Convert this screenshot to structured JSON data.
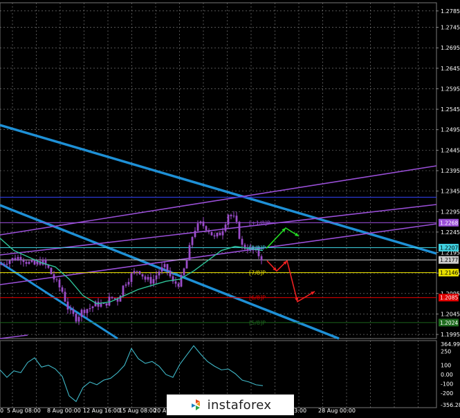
{
  "colors": {
    "background": "#000000",
    "grid": "#8a8a8a",
    "text": "#ffffff",
    "candles": "#9b4dca",
    "ma_line": "#2fc59a",
    "channel_blue": "#1e90d6",
    "channel_purple": "#9a4fd8",
    "resistance_blue": "#2c3ad6",
    "level_white": "#cccccc",
    "level_cyan": "#3fd0e0",
    "level_yellow": "#e8e000",
    "level_red": "#e00000",
    "level_green": "#1e6b1e",
    "arrow_green": "#22dd22",
    "arrow_red": "#ee2222",
    "cci_line": "#3fb8c8"
  },
  "chart_data": [
    {
      "type": "candlestick",
      "title": "",
      "price_axis_ticks": [
        "1.2785",
        "1.2745",
        "1.2695",
        "1.2645",
        "1.2595",
        "1.2545",
        "1.2495",
        "1.2445",
        "1.2395",
        "1.2345",
        "1.2295",
        "1.2245",
        "1.2195",
        "1.2145",
        "1.2095",
        "1.2045",
        "1.1995"
      ],
      "ylim": [
        1.1985,
        1.2805
      ],
      "price_axis_tags": [
        {
          "value": "1.2268",
          "color": "#9a4fd8"
        },
        {
          "value": "1.2207",
          "color": "#3fd0e0"
        },
        {
          "value": "1.2177",
          "color": "#cccccc"
        },
        {
          "value": "1.2146",
          "color": "#e8e000"
        },
        {
          "value": "1.2085",
          "color": "#e00000"
        },
        {
          "value": "1.2024",
          "color": "#1e6b1e"
        }
      ],
      "level_labels": [
        {
          "text": "[+1/8]P",
          "price": 1.2268,
          "color": "#9a4fd8"
        },
        {
          "text": "[8/8]P",
          "price": 1.2207,
          "color": "#3fd0e0"
        },
        {
          "text": "[7/8]P",
          "price": 1.2146,
          "color": "#e8e000"
        },
        {
          "text": "[6/8]P",
          "price": 1.2085,
          "color": "#e00000"
        },
        {
          "text": "[5/8]P",
          "price": 1.2024,
          "color": "#1e6b1e"
        }
      ],
      "resistance_level": 1.233,
      "series": [
        {
          "name": "",
          "kind": "price_close",
          "x": [
            0,
            10,
            20,
            30,
            40,
            50,
            60,
            70,
            80,
            90,
            100,
            110,
            120,
            130,
            140,
            150,
            160,
            170,
            180,
            190,
            200,
            210,
            220,
            230,
            240,
            250,
            260,
            270,
            280,
            290,
            300,
            310,
            320,
            330,
            340,
            350,
            360,
            370,
            380
          ],
          "values": [
            1.2165,
            1.2175,
            1.218,
            1.2185,
            1.217,
            1.2165,
            1.2175,
            1.2155,
            1.2125,
            1.21,
            1.205,
            1.2035,
            1.2055,
            1.206,
            1.207,
            1.2065,
            1.2085,
            1.208,
            1.212,
            1.214,
            1.2155,
            1.213,
            1.2125,
            1.215,
            1.216,
            1.212,
            1.212,
            1.2175,
            1.225,
            1.2265,
            1.2255,
            1.223,
            1.2245,
            1.229,
            1.2275,
            1.221,
            1.2205,
            1.2195,
            1.218
          ]
        },
        {
          "name": "",
          "kind": "moving_average",
          "x": [
            0,
            20,
            40,
            60,
            80,
            100,
            120,
            140,
            160,
            180,
            200,
            220,
            240,
            260,
            280,
            300,
            320,
            340,
            360,
            380
          ],
          "values": [
            1.223,
            1.22,
            1.2185,
            1.217,
            1.216,
            1.213,
            1.209,
            1.207,
            1.2075,
            1.209,
            1.2105,
            1.2115,
            1.2125,
            1.213,
            1.215,
            1.2175,
            1.22,
            1.221,
            1.2205,
            1.22
          ]
        }
      ],
      "forecast_arrows": {
        "green": [
          [
            385,
            1.2205
          ],
          [
            413,
            1.2255
          ],
          [
            432,
            1.2235
          ]
        ],
        "red": [
          [
            386,
            1.2175
          ],
          [
            400,
            1.215
          ],
          [
            415,
            1.2175
          ],
          [
            430,
            1.2075
          ],
          [
            455,
            1.21
          ]
        ]
      }
    },
    {
      "type": "line",
      "title": "",
      "y_axis_ticks": [
        "364.9945",
        "250",
        "100",
        "0.00",
        "-100",
        "-200",
        "-356.2847"
      ],
      "ylim": [
        -356.2847,
        364.9945
      ],
      "x_axis_labels": [
        "0",
        "5 Aug 08:00",
        "8 Aug 00:00",
        "12 Aug 16:00",
        "15 Aug 08:00",
        "20 Au",
        "03:00",
        "28 Aug 00:00"
      ],
      "series": [
        {
          "name": "",
          "x": [
            0,
            10,
            20,
            30,
            40,
            50,
            60,
            70,
            80,
            90,
            100,
            110,
            120,
            130,
            140,
            150,
            160,
            170,
            180,
            190,
            200,
            210,
            220,
            230,
            240,
            250,
            260,
            270,
            280,
            290,
            300,
            310,
            320,
            330,
            340,
            350,
            360,
            370,
            380
          ],
          "values": [
            50,
            -30,
            40,
            20,
            130,
            180,
            80,
            100,
            60,
            -20,
            -230,
            -290,
            -140,
            -80,
            -110,
            -60,
            -40,
            20,
            100,
            280,
            170,
            120,
            140,
            90,
            0,
            -30,
            110,
            210,
            310,
            220,
            140,
            90,
            50,
            60,
            10,
            -60,
            -80,
            -110,
            -120
          ]
        }
      ]
    }
  ],
  "logo": {
    "text": "instaforex"
  }
}
